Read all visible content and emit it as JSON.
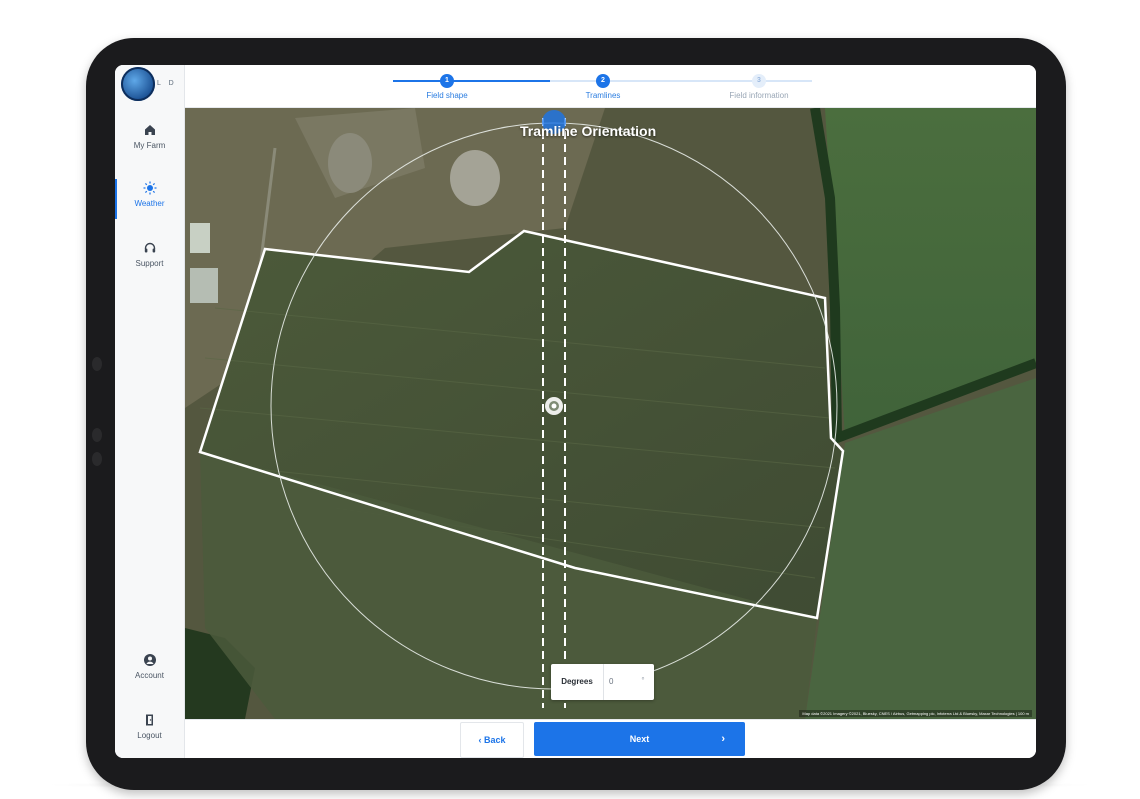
{
  "app": {
    "logo_text": "L D"
  },
  "sidebar": {
    "items": [
      {
        "label": "My Farm",
        "icon": "home-icon"
      },
      {
        "label": "Weather",
        "icon": "sun-icon"
      },
      {
        "label": "Support",
        "icon": "headset-icon"
      },
      {
        "label": "Account",
        "icon": "account-icon"
      },
      {
        "label": "Logout",
        "icon": "logout-icon"
      }
    ],
    "active": "Weather"
  },
  "stepper": {
    "steps": [
      {
        "number": "1",
        "label": "Field shape",
        "state": "complete"
      },
      {
        "number": "2",
        "label": "Tramlines",
        "state": "current"
      },
      {
        "number": "3",
        "label": "Field information",
        "state": "upcoming"
      }
    ]
  },
  "map": {
    "title": "Tramline Orientation",
    "attribution": "Map data ©2021 Imagery ©2021, Bluesky, CNES / Airbus, Getmapping plc, Infoterra Ltd & Bluesky, Maxar Technologies | 100 m"
  },
  "orientation": {
    "label": "Degrees",
    "value": "0",
    "unit_glyph": "°"
  },
  "footer": {
    "back_label": "Back",
    "back_icon": "chevron-left-icon",
    "next_label": "Next",
    "next_icon": "chevron-right-icon"
  },
  "colors": {
    "accent": "#1c74e8",
    "sidebar_bg": "#f7f8f9",
    "device_frame": "#1b1b1d"
  }
}
